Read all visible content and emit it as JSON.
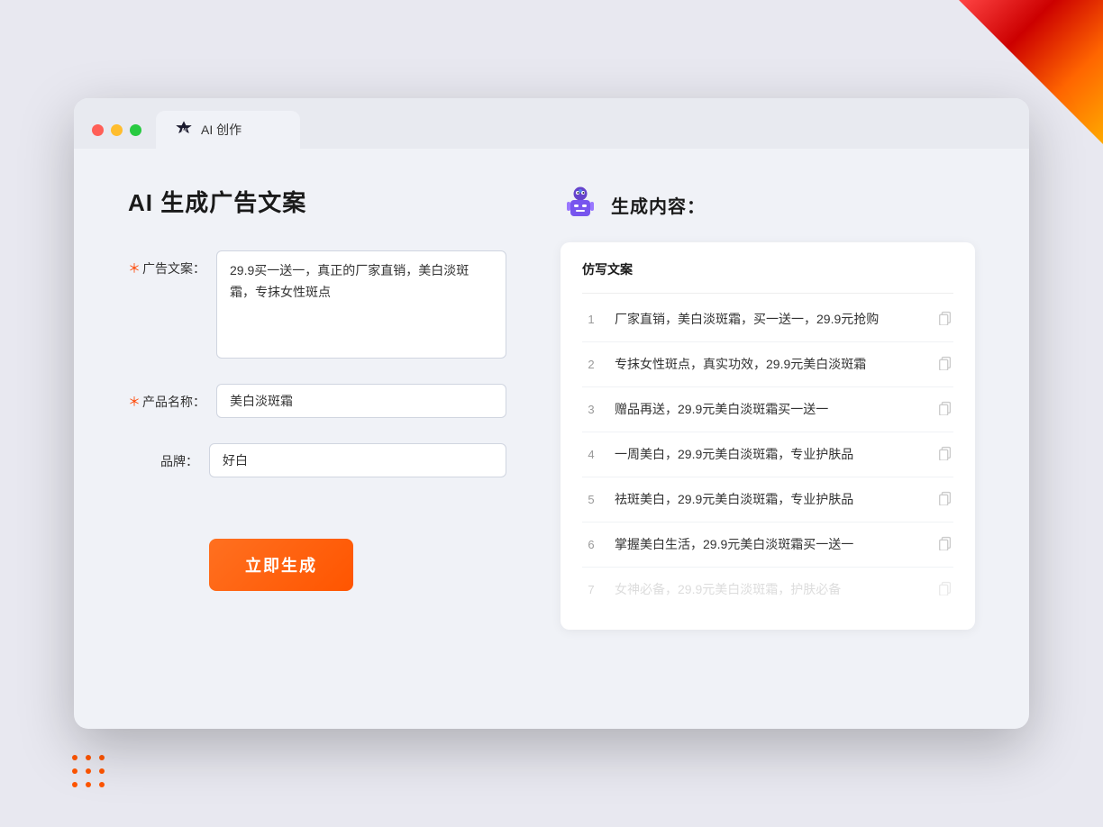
{
  "window": {
    "tab_title": "AI 创作",
    "traffic_lights": [
      "red",
      "yellow",
      "green"
    ]
  },
  "left_panel": {
    "page_title": "AI 生成广告文案",
    "form": {
      "ad_copy_label": "广告文案：",
      "ad_copy_required": "＊",
      "ad_copy_value": "29.9买一送一，真正的厂家直销，美白淡斑霜，专抹女性斑点",
      "product_name_label": "产品名称：",
      "product_name_required": "＊",
      "product_name_value": "美白淡斑霜",
      "brand_label": "品牌：",
      "brand_value": "好白",
      "generate_button": "立即生成"
    }
  },
  "right_panel": {
    "title": "生成内容：",
    "table_header": "仿写文案",
    "results": [
      {
        "num": "1",
        "text": "厂家直销，美白淡斑霜，买一送一，29.9元抢购",
        "faded": false
      },
      {
        "num": "2",
        "text": "专抹女性斑点，真实功效，29.9元美白淡斑霜",
        "faded": false
      },
      {
        "num": "3",
        "text": "赠品再送，29.9元美白淡斑霜买一送一",
        "faded": false
      },
      {
        "num": "4",
        "text": "一周美白，29.9元美白淡斑霜，专业护肤品",
        "faded": false
      },
      {
        "num": "5",
        "text": "祛斑美白，29.9元美白淡斑霜，专业护肤品",
        "faded": false
      },
      {
        "num": "6",
        "text": "掌握美白生活，29.9元美白淡斑霜买一送一",
        "faded": false
      },
      {
        "num": "7",
        "text": "女神必备，29.9元美白淡斑霜，护肤必备",
        "faded": true
      }
    ]
  }
}
